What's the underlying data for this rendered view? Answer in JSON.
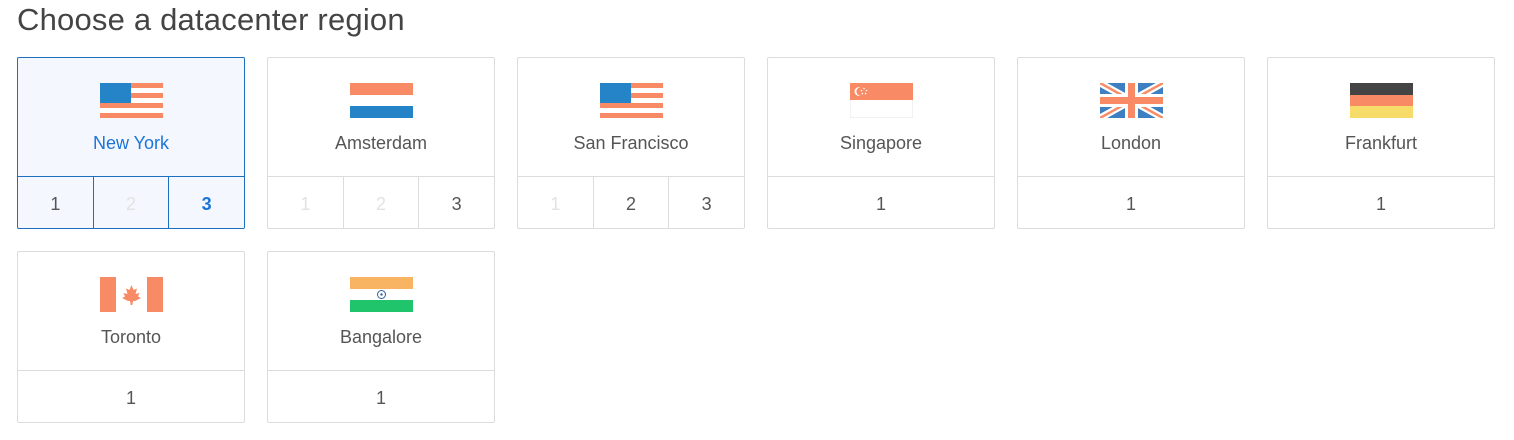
{
  "title": "Choose a datacenter region",
  "colors": {
    "selected_border": "#1f6fbf",
    "selected_text": "#1b75d8",
    "selected_bg": "#f4f8fe",
    "disabled_text": "#e2e2e2"
  },
  "regions": [
    {
      "name": "New York",
      "flag": "us-flag-icon",
      "selected": true,
      "datacenters": [
        {
          "label": "1",
          "state": "enabled"
        },
        {
          "label": "2",
          "state": "disabled"
        },
        {
          "label": "3",
          "state": "active"
        }
      ]
    },
    {
      "name": "Amsterdam",
      "flag": "netherlands-flag-icon",
      "selected": false,
      "datacenters": [
        {
          "label": "1",
          "state": "disabled"
        },
        {
          "label": "2",
          "state": "disabled"
        },
        {
          "label": "3",
          "state": "enabled"
        }
      ]
    },
    {
      "name": "San Francisco",
      "flag": "us-flag-icon",
      "selected": false,
      "datacenters": [
        {
          "label": "1",
          "state": "disabled"
        },
        {
          "label": "2",
          "state": "enabled"
        },
        {
          "label": "3",
          "state": "enabled"
        }
      ]
    },
    {
      "name": "Singapore",
      "flag": "singapore-flag-icon",
      "selected": false,
      "datacenters": [
        {
          "label": "1",
          "state": "enabled"
        }
      ]
    },
    {
      "name": "London",
      "flag": "uk-flag-icon",
      "selected": false,
      "datacenters": [
        {
          "label": "1",
          "state": "enabled"
        }
      ]
    },
    {
      "name": "Frankfurt",
      "flag": "germany-flag-icon",
      "selected": false,
      "datacenters": [
        {
          "label": "1",
          "state": "enabled"
        }
      ]
    },
    {
      "name": "Toronto",
      "flag": "canada-flag-icon",
      "selected": false,
      "datacenters": [
        {
          "label": "1",
          "state": "enabled"
        }
      ]
    },
    {
      "name": "Bangalore",
      "flag": "india-flag-icon",
      "selected": false,
      "datacenters": [
        {
          "label": "1",
          "state": "enabled"
        }
      ]
    }
  ]
}
